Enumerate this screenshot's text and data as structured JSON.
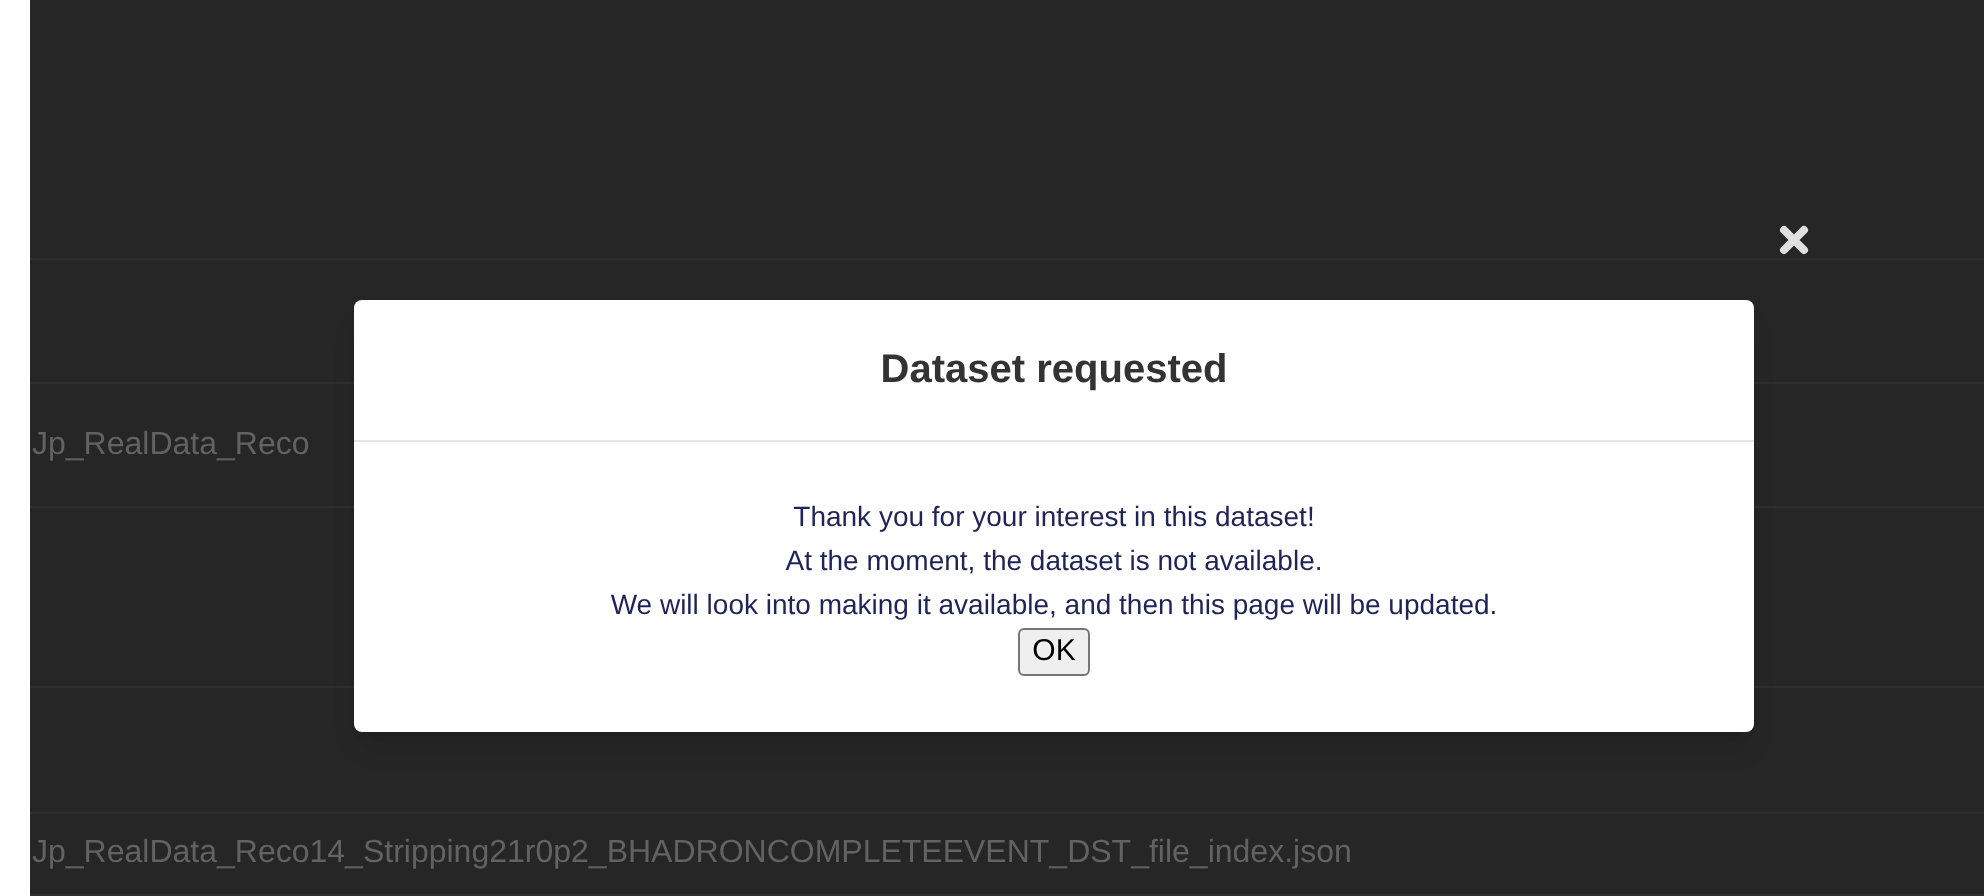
{
  "background_rows": [
    {},
    {
      "text": "Jp_RealData_Reco"
    },
    {},
    {},
    {
      "text": "Jp_RealData_Reco14_Stripping21r0p2_BHADRONCOMPLETEEVENT_DST_file_index.json"
    }
  ],
  "dialog": {
    "title": "Dataset requested",
    "lines": [
      "Thank you for your interest in this dataset!",
      "At the moment, the dataset is not available.",
      "We will look into making it available, and then this page will be updated."
    ],
    "button": "OK"
  }
}
